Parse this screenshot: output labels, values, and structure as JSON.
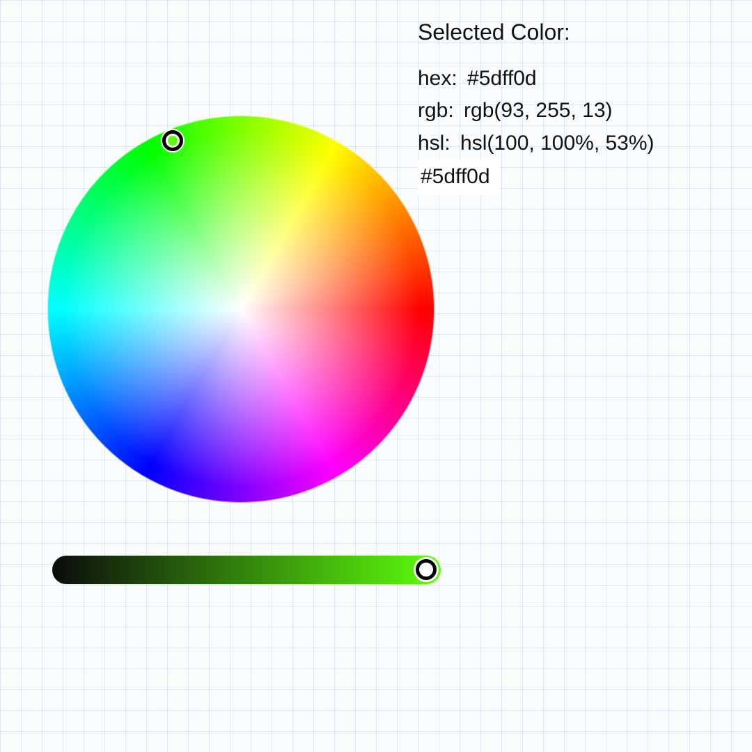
{
  "info": {
    "title": "Selected Color:",
    "hex_label": "hex: ",
    "hex_value": "#5dff0d",
    "rgb_label": "rgb: ",
    "rgb_value": "rgb(93, 255, 13)",
    "hsl_label": "hsl: ",
    "hsl_value": "hsl(100, 100%, 53%)",
    "swatch_text": "#5dff0d"
  },
  "wheel": {
    "handle_left_px": "248",
    "handle_top_px": "202"
  },
  "slider": {
    "handle_left_px": "612",
    "handle_top_px": "818"
  }
}
